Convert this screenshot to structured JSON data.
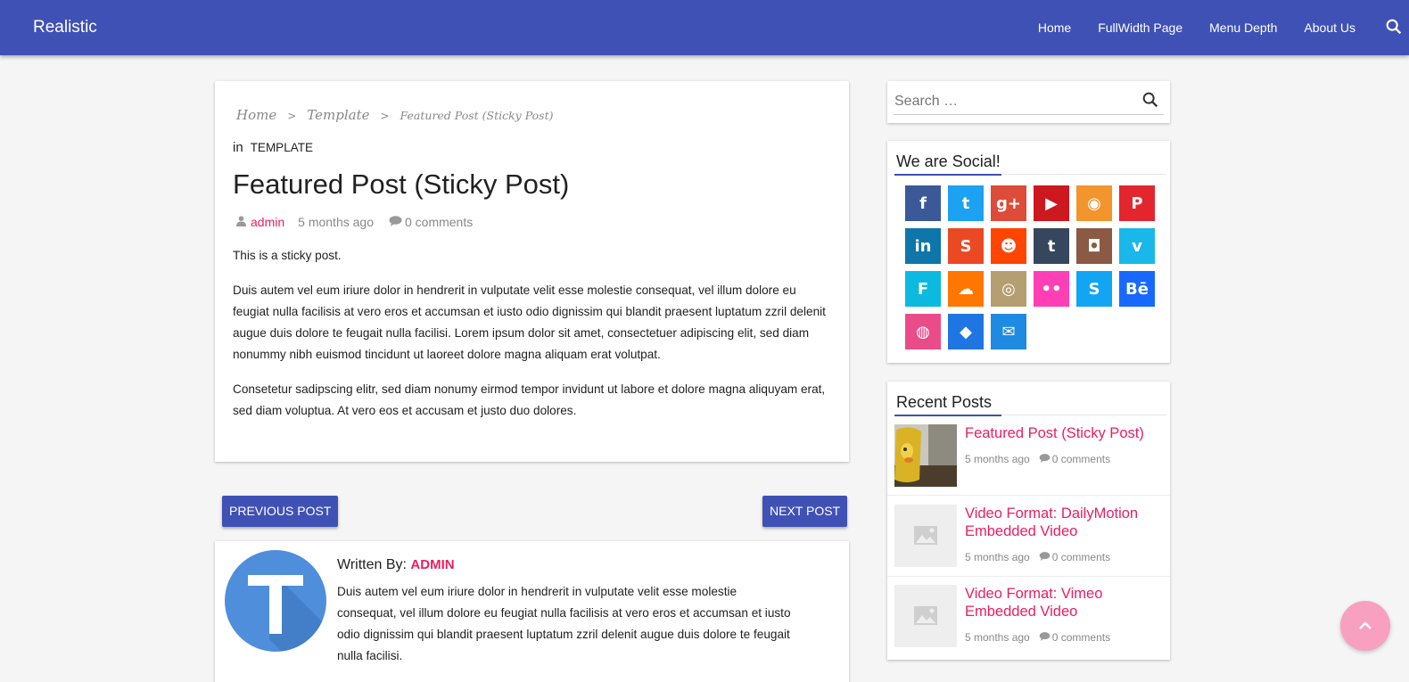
{
  "header": {
    "brand": "Realistic",
    "nav": [
      "Home",
      "FullWidth Page",
      "Menu Depth",
      "About Us"
    ]
  },
  "breadcrumb": {
    "home": "Home",
    "sep": ">",
    "section": "Template",
    "current": "Featured Post (Sticky Post)"
  },
  "post": {
    "in_label": "in",
    "category": "TEMPLATE",
    "title": "Featured Post (Sticky Post)",
    "author": "admin",
    "date": "5 months ago",
    "comments": "0 comments",
    "paragraphs": [
      "This is a sticky post.",
      "Duis autem vel eum iriure dolor in hendrerit in vulputate velit esse molestie consequat, vel illum dolore eu feugiat nulla facilisis at vero eros et accumsan et iusto odio dignissim qui blandit praesent luptatum zzril delenit augue duis dolore te feugait nulla facilisi. Lorem ipsum dolor sit amet, consectetuer adipiscing elit, sed diam nonummy nibh euismod tincidunt ut laoreet dolore magna aliquam erat volutpat.",
      "Consetetur sadipscing elitr, sed diam nonumy eirmod tempor invidunt ut labore et dolore magna aliquyam erat, sed diam voluptua. At vero eos et accusam et justo duo dolores."
    ]
  },
  "pager": {
    "prev": "PREVIOUS POST",
    "next": "NEXT POST"
  },
  "author_box": {
    "written_by": "Written By:",
    "name": "ADMIN",
    "bio": "Duis autem vel eum iriure dolor in hendrerit in vulputate velit esse molestie consequat, vel illum dolore eu feugiat nulla facilisis at vero eros et accumsan et iusto odio dignissim qui blandit praesent luptatum zzril delenit augue duis dolore te feugait nulla facilisi.",
    "avatar_letter": "T"
  },
  "search": {
    "placeholder": "Search …"
  },
  "social": {
    "title": "We are Social!",
    "icons": [
      {
        "name": "facebook-icon",
        "glyph": "f",
        "color": "#3b5998"
      },
      {
        "name": "twitter-icon",
        "glyph": "t",
        "color": "#1da1f2"
      },
      {
        "name": "google-plus-icon",
        "glyph": "g+",
        "color": "#dd4b39"
      },
      {
        "name": "youtube-icon",
        "glyph": "▶",
        "color": "#cc181e"
      },
      {
        "name": "rss-icon",
        "glyph": "◉",
        "color": "#f2952c"
      },
      {
        "name": "pinterest-icon",
        "glyph": "P",
        "color": "#e3262e"
      },
      {
        "name": "linkedin-icon",
        "glyph": "in",
        "color": "#0e76a8"
      },
      {
        "name": "stumbleupon-icon",
        "glyph": "S",
        "color": "#eb4924"
      },
      {
        "name": "reddit-icon",
        "glyph": "☻",
        "color": "#ff4500"
      },
      {
        "name": "tumblr-icon",
        "glyph": "t",
        "color": "#36465d"
      },
      {
        "name": "instagram-icon",
        "glyph": "◘",
        "color": "#8a5a44"
      },
      {
        "name": "vimeo-icon",
        "glyph": "v",
        "color": "#1ab7ea"
      },
      {
        "name": "foursquare-icon",
        "glyph": "F",
        "color": "#0cbadf"
      },
      {
        "name": "soundcloud-icon",
        "glyph": "☁",
        "color": "#ff7700"
      },
      {
        "name": "github-icon",
        "glyph": "◎",
        "color": "#b59e71"
      },
      {
        "name": "flickr-icon",
        "glyph": "••",
        "color": "#ff3fb4"
      },
      {
        "name": "skype-icon",
        "glyph": "S",
        "color": "#12a5f4"
      },
      {
        "name": "behance-icon",
        "glyph": "Bē",
        "color": "#1769ff"
      },
      {
        "name": "dribbble-icon",
        "glyph": "◍",
        "color": "#ea4c89"
      },
      {
        "name": "dropbox-icon",
        "glyph": "◆",
        "color": "#1f75e1"
      },
      {
        "name": "email-icon",
        "glyph": "✉",
        "color": "#1f8ae1"
      }
    ]
  },
  "recent": {
    "title": "Recent Posts",
    "items": [
      {
        "title": "Featured Post (Sticky Post)",
        "date": "5 months ago",
        "comments": "0 comments"
      },
      {
        "title": "Video Format: DailyMotion Embedded Video",
        "date": "5 months ago",
        "comments": "0 comments"
      },
      {
        "title": "Video Format: Vimeo Embedded Video",
        "date": "5 months ago",
        "comments": "0 comments"
      }
    ]
  },
  "colors": {
    "primary": "#3f51b5",
    "accent": "#e91e63"
  }
}
